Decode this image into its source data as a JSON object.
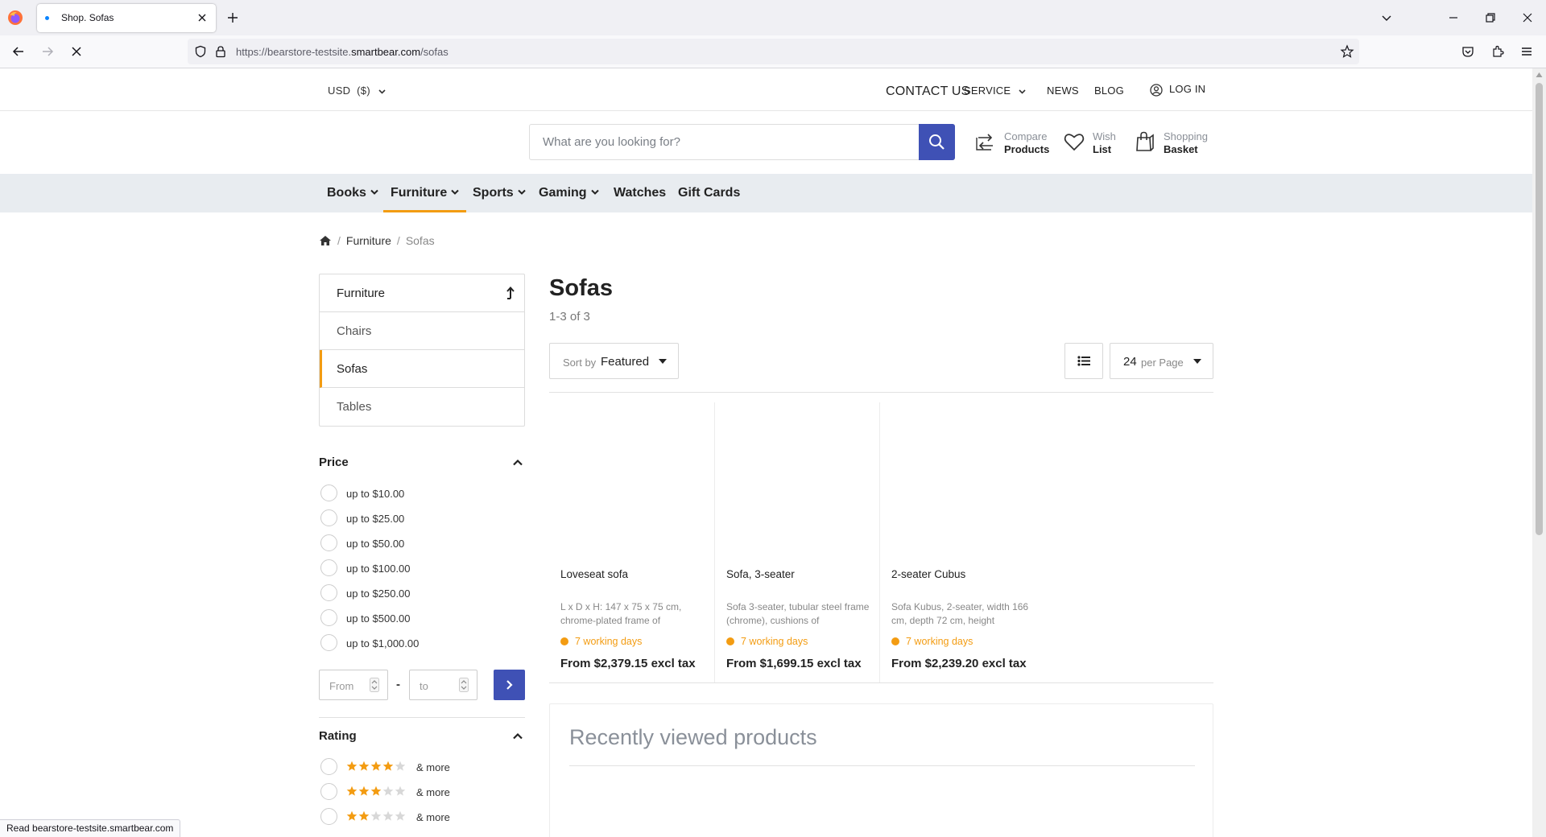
{
  "browser": {
    "tab_title": "Shop. Sofas",
    "url_prefix": "https://bearstore-testsite.",
    "url_domain": "smartbear.com",
    "url_path": "/sofas",
    "status_text": "Read bearstore-testsite.smartbear.com"
  },
  "topbar": {
    "currency": "USD  ($)",
    "contact": "CONTACT US",
    "service": "SERVICE",
    "news": "NEWS",
    "blog": "BLOG",
    "login": "LOG IN"
  },
  "header": {
    "search_placeholder": "What are you looking for?",
    "compare_line1": "Compare",
    "compare_line2": "Products",
    "wish_line1": "Wish",
    "wish_line2": "List",
    "basket_line1": "Shopping",
    "basket_line2": "Basket"
  },
  "categories": [
    {
      "label": "Books",
      "has_dropdown": true,
      "active": false
    },
    {
      "label": "Furniture",
      "has_dropdown": true,
      "active": true
    },
    {
      "label": "Sports",
      "has_dropdown": true,
      "active": false
    },
    {
      "label": "Gaming",
      "has_dropdown": true,
      "active": false
    },
    {
      "label": "Watches",
      "has_dropdown": false,
      "active": false
    },
    {
      "label": "Gift Cards",
      "has_dropdown": false,
      "active": false
    }
  ],
  "breadcrumb": {
    "parent": "Furniture",
    "current": "Sofas"
  },
  "sidebar": {
    "parent_category": "Furniture",
    "items": [
      {
        "label": "Chairs",
        "active": false
      },
      {
        "label": "Sofas",
        "active": true
      },
      {
        "label": "Tables",
        "active": false
      }
    ],
    "price_title": "Price",
    "price_options": [
      "up to $10.00",
      "up to $25.00",
      "up to $50.00",
      "up to $100.00",
      "up to $250.00",
      "up to $500.00",
      "up to $1,000.00"
    ],
    "price_from_placeholder": "From",
    "price_dash": "-",
    "price_to_placeholder": "to",
    "rating_title": "Rating",
    "rating_options": [
      {
        "stars": 4,
        "label": "& more"
      },
      {
        "stars": 3,
        "label": "& more"
      },
      {
        "stars": 2,
        "label": "& more"
      }
    ]
  },
  "main": {
    "title": "Sofas",
    "count": "1-3 of 3",
    "sort_prefix": "Sort by",
    "sort_value": "Featured",
    "per_page_value": "24",
    "per_page_suffix": "per Page",
    "products": [
      {
        "name": "Loveseat sofa",
        "description": "L x D x H: 147 x 75 x 75 cm, chrome-plated frame of",
        "delivery": "7 working days",
        "price": "From $2,379.15 excl tax"
      },
      {
        "name": "Sofa, 3-seater",
        "description": "Sofa 3-seater, tubular steel frame (chrome), cushions of",
        "delivery": "7 working days",
        "price": "From $1,699.15 excl tax"
      },
      {
        "name": "2-seater Cubus",
        "description": "Sofa Kubus, 2-seater, width 166 cm, depth 72 cm, height",
        "delivery": "7 working days",
        "price": "From $2,239.20 excl tax"
      }
    ],
    "recently_viewed_title": "Recently viewed products"
  },
  "colors": {
    "accent": "#3f51b5",
    "highlight": "#f39c12",
    "nav_background": "#e8ecf0"
  }
}
